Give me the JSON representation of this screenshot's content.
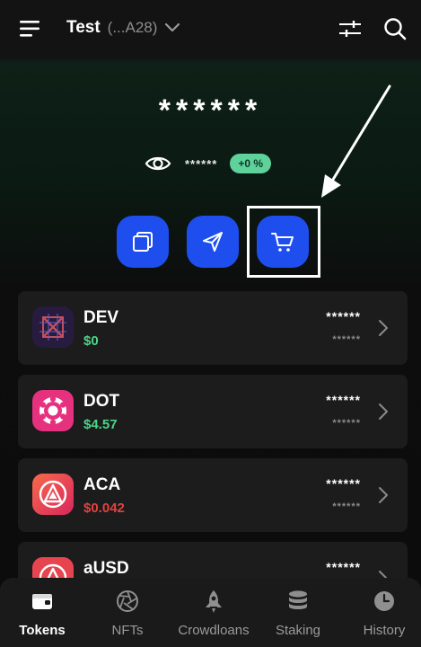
{
  "header": {
    "account_name": "Test",
    "account_address": "(...A28)",
    "menu_icon": "hamburger-menu-icon",
    "account_icon": "chevron-down-icon",
    "filter_icon": "sliders-icon",
    "search_icon": "search-icon"
  },
  "balance": {
    "total": "******",
    "hidden_sub": "******",
    "change_percent": "+0 %",
    "visibility_icon": "eye-icon"
  },
  "actions": [
    {
      "name": "receive",
      "icon": "copy-icon"
    },
    {
      "name": "send",
      "icon": "paper-plane-icon"
    },
    {
      "name": "buy",
      "icon": "cart-icon"
    }
  ],
  "tokens": [
    {
      "symbol": "DEV",
      "price": "$0",
      "amount": "******",
      "value": "******",
      "price_color": "#4cd487"
    },
    {
      "symbol": "DOT",
      "price": "$4.57",
      "amount": "******",
      "value": "******",
      "price_color": "#4cd487"
    },
    {
      "symbol": "ACA",
      "price": "$0.042",
      "amount": "******",
      "value": "******",
      "price_color": "#e0423f"
    },
    {
      "symbol": "aUSD",
      "price": "",
      "amount": "******",
      "value": "",
      "price_color": "#4cd487"
    }
  ],
  "nav": {
    "tokens": "Tokens",
    "nfts": "NFTs",
    "crowdloans": "Crowdloans",
    "staking": "Staking",
    "history": "History"
  },
  "colors": {
    "accent": "#1e4fee",
    "badge": "#5fd29c",
    "positive": "#4cd487",
    "negative": "#e0423f"
  }
}
